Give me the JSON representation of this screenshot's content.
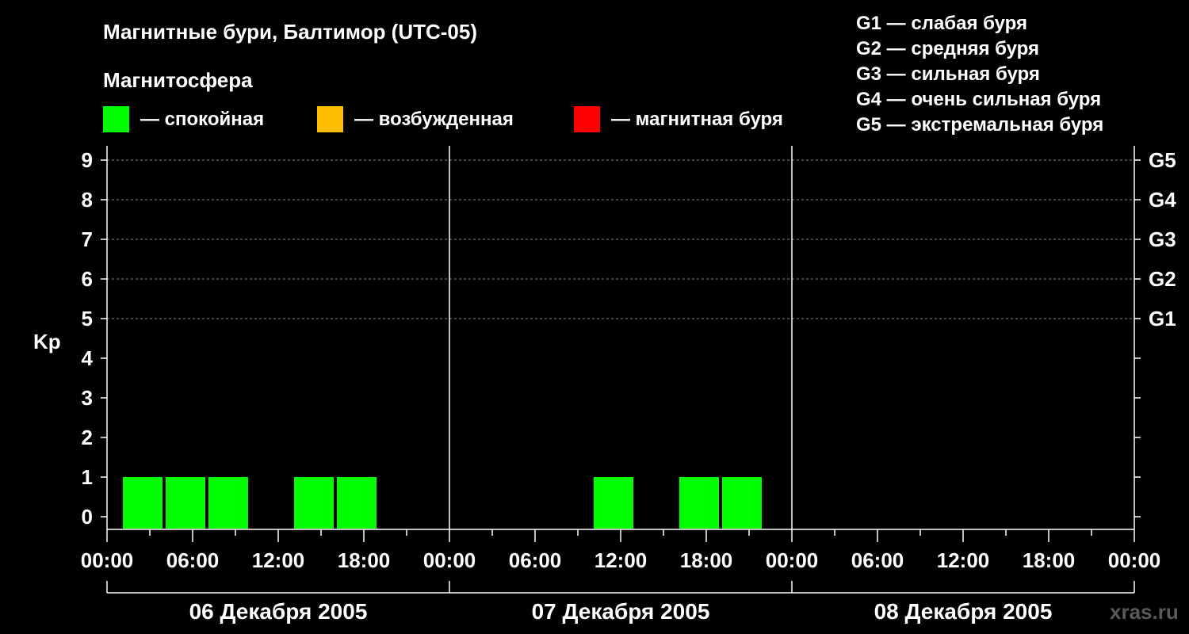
{
  "title": "Магнитные бури, Балтимор (UTC-05)",
  "magnetosphere_heading": "Магнитосфера",
  "states": [
    {
      "label": "— спокойная",
      "color": "#00ff00"
    },
    {
      "label": "— возбужденная",
      "color": "#ffbf00"
    },
    {
      "label": "— магнитная буря",
      "color": "#ff0000"
    }
  ],
  "g_legend": [
    "G1 — слабая буря",
    "G2 — средняя буря",
    "G3 — сильная буря",
    "G4 — очень сильная буря",
    "G5 — экстремальная буря"
  ],
  "watermark": "xras.ru",
  "chart_data": {
    "type": "bar",
    "ylabel": "Kp",
    "ylim": [
      0,
      9
    ],
    "y_ticks": [
      "0",
      "1",
      "2",
      "3",
      "4",
      "5",
      "6",
      "7",
      "8",
      "9"
    ],
    "g_levels": [
      {
        "kp": 5,
        "label": "G1"
      },
      {
        "kp": 6,
        "label": "G2"
      },
      {
        "kp": 7,
        "label": "G3"
      },
      {
        "kp": 8,
        "label": "G4"
      },
      {
        "kp": 9,
        "label": "G5"
      }
    ],
    "x_tick_labels": [
      "00:00",
      "06:00",
      "12:00",
      "18:00",
      "00:00",
      "06:00",
      "12:00",
      "18:00",
      "00:00",
      "06:00",
      "12:00",
      "18:00",
      "00:00"
    ],
    "days": [
      "06 Декабря 2005",
      "07 Декабря 2005",
      "08 Декабря 2005"
    ],
    "x_range_hours": [
      0,
      72
    ],
    "bar_width_hours": 3,
    "bars": [
      {
        "start_hour": 1,
        "kp": 1,
        "state": "спокойная"
      },
      {
        "start_hour": 4,
        "kp": 1,
        "state": "спокойная"
      },
      {
        "start_hour": 7,
        "kp": 1,
        "state": "спокойная"
      },
      {
        "start_hour": 13,
        "kp": 1,
        "state": "спокойная"
      },
      {
        "start_hour": 16,
        "kp": 1,
        "state": "спокойная"
      },
      {
        "start_hour": 34,
        "kp": 1,
        "state": "спокойная"
      },
      {
        "start_hour": 40,
        "kp": 1,
        "state": "спокойная"
      },
      {
        "start_hour": 43,
        "kp": 1,
        "state": "спокойная"
      }
    ],
    "grid": true
  }
}
